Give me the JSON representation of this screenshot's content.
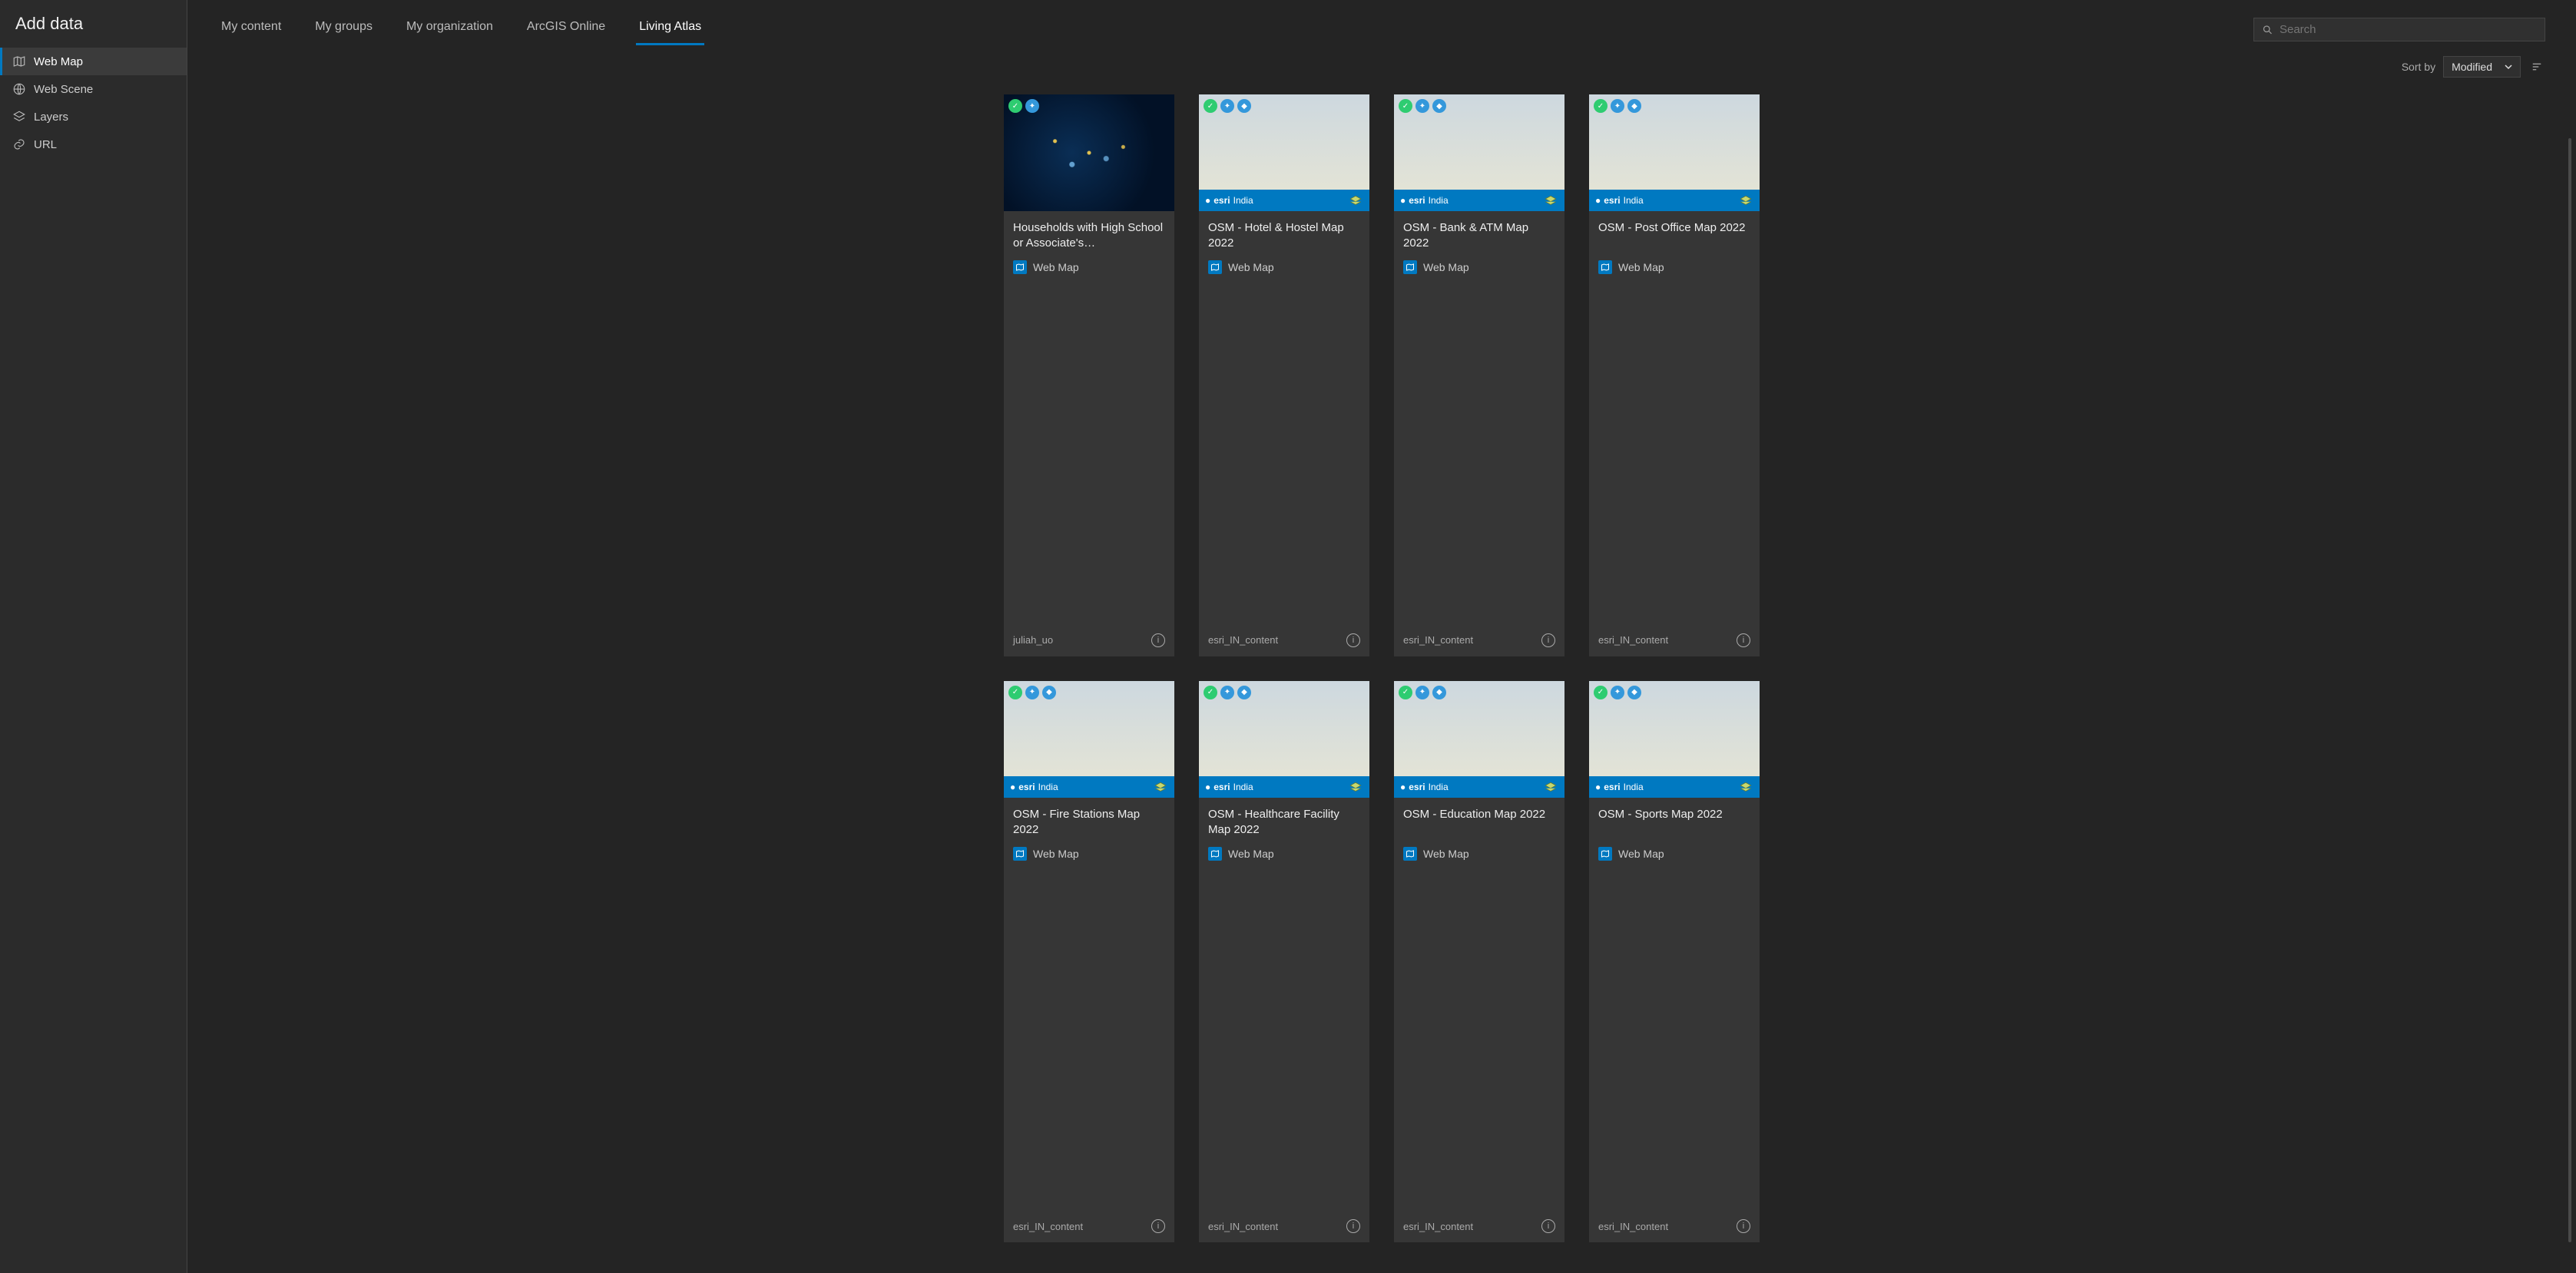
{
  "title": "Add data",
  "sidebar": {
    "items": [
      {
        "label": "Web Map"
      },
      {
        "label": "Web Scene"
      },
      {
        "label": "Layers"
      },
      {
        "label": "URL"
      }
    ]
  },
  "tabs": {
    "items": [
      {
        "label": "My content"
      },
      {
        "label": "My groups"
      },
      {
        "label": "My organization"
      },
      {
        "label": "ArcGIS Online"
      },
      {
        "label": "Living Atlas"
      }
    ]
  },
  "search": {
    "placeholder": "Search"
  },
  "sort": {
    "label": "Sort by",
    "value": "Modified"
  },
  "type_label": "Web Map",
  "esri_brand": {
    "name": "esri",
    "region": "India"
  },
  "cards": [
    {
      "title": "Households with High School or Associate's…",
      "owner": "juliah_uo"
    },
    {
      "title": "OSM - Hotel & Hostel Map 2022",
      "owner": "esri_IN_content"
    },
    {
      "title": "OSM - Bank & ATM Map 2022",
      "owner": "esri_IN_content"
    },
    {
      "title": "OSM - Post Office Map 2022",
      "owner": "esri_IN_content"
    },
    {
      "title": "OSM - Fire Stations Map 2022",
      "owner": "esri_IN_content"
    },
    {
      "title": "OSM - Healthcare Facility Map 2022",
      "owner": "esri_IN_content"
    },
    {
      "title": "OSM - Education Map 2022",
      "owner": "esri_IN_content"
    },
    {
      "title": "OSM - Sports Map 2022",
      "owner": "esri_IN_content"
    }
  ]
}
